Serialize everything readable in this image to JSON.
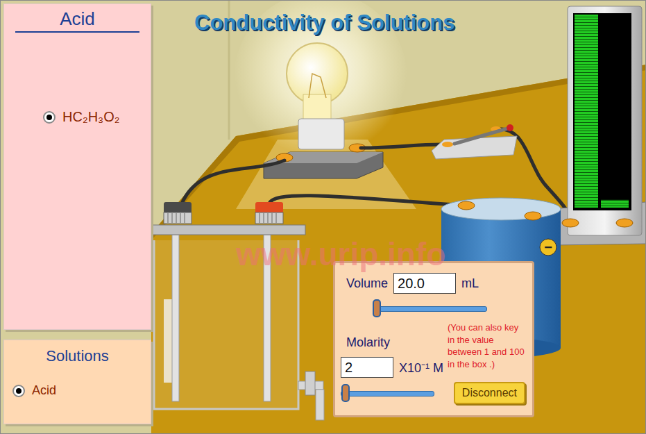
{
  "title": "Conductivity of Solutions",
  "acid_panel": {
    "heading": "Acid",
    "options": [
      {
        "label": "HC₂H₃O₂",
        "selected": true
      }
    ]
  },
  "solutions_panel": {
    "heading": "Solutions",
    "options": [
      {
        "label": "Acid",
        "selected": true
      }
    ]
  },
  "circuit": {
    "bulb_lit": true,
    "switch_closed": true,
    "meter": {
      "level": 0.04
    },
    "battery": {
      "terminal": "−"
    }
  },
  "watermark": "www.urip.info",
  "controls": {
    "volume": {
      "label": "Volume",
      "value": "20.0",
      "unit": "mL",
      "level": 0.0
    },
    "molarity": {
      "label": "Molarity",
      "value": "2",
      "unit": "X10⁻¹ M",
      "level": 0.01
    },
    "hint": "(You can also key in the value between 1 and 100 in the box .)",
    "button": "Disconnect"
  }
}
